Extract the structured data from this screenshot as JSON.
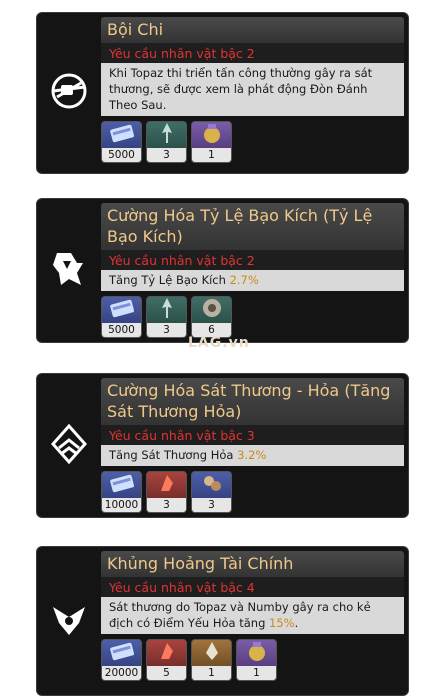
{
  "watermark": "LAG.vn",
  "cards": [
    {
      "title": "Bội Chi",
      "requirement": "Yêu cầu nhân vật bậc 2",
      "description": "Khi Topaz thi triển tấn công thường gây ra sát thương, sẽ được xem là phát động Đòn Đánh Theo Sau.",
      "description_highlight": "",
      "icon": "crossed-emblem-icon",
      "materials": [
        {
          "icon": "credit-card-icon",
          "count": "5000",
          "rarity": "blue"
        },
        {
          "icon": "arrowhead-icon",
          "count": "3",
          "rarity": "green"
        },
        {
          "icon": "treasure-pot-icon",
          "count": "1",
          "rarity": "purple"
        }
      ]
    },
    {
      "title": "Cường Hóa Tỷ Lệ Bạo Kích (Tỷ Lệ Bạo Kích)",
      "requirement": "Yêu cầu nhân vật bậc 2",
      "description": "Tăng Tỷ Lệ Bạo Kích ",
      "description_highlight": "2.7%",
      "icon": "crit-rate-icon",
      "materials": [
        {
          "icon": "credit-card-icon",
          "count": "5000",
          "rarity": "blue"
        },
        {
          "icon": "arrowhead-icon",
          "count": "3",
          "rarity": "green"
        },
        {
          "icon": "gear-orb-icon",
          "count": "6",
          "rarity": "green"
        }
      ]
    },
    {
      "title": "Cường Hóa Sát Thương - Hỏa (Tăng Sát Thương Hỏa)",
      "requirement": "Yêu cầu nhân vật bậc 3",
      "description": "Tăng Sát Thương Hỏa ",
      "description_highlight": "3.2%",
      "icon": "fire-damage-icon",
      "materials": [
        {
          "icon": "credit-card-icon",
          "count": "10000",
          "rarity": "blue"
        },
        {
          "icon": "flame-shard-icon",
          "count": "3",
          "rarity": "red"
        },
        {
          "icon": "gear-cluster-icon",
          "count": "3",
          "rarity": "blue"
        }
      ]
    },
    {
      "title": "Khủng Hoảng Tài Chính",
      "requirement": "Yêu cầu nhân vật bậc 4",
      "description": "Sát thương do Topaz và Numby gây ra cho kẻ địch có Điểm Yếu Hỏa tăng ",
      "description_highlight": "15%",
      "description_suffix": ".",
      "icon": "phoenix-emblem-icon",
      "materials": [
        {
          "icon": "credit-card-icon",
          "count": "20000",
          "rarity": "blue"
        },
        {
          "icon": "flame-shard-icon",
          "count": "5",
          "rarity": "red"
        },
        {
          "icon": "crystal-plume-icon",
          "count": "1",
          "rarity": "gold"
        },
        {
          "icon": "treasure-pot-icon",
          "count": "1",
          "rarity": "purple"
        }
      ]
    }
  ]
}
